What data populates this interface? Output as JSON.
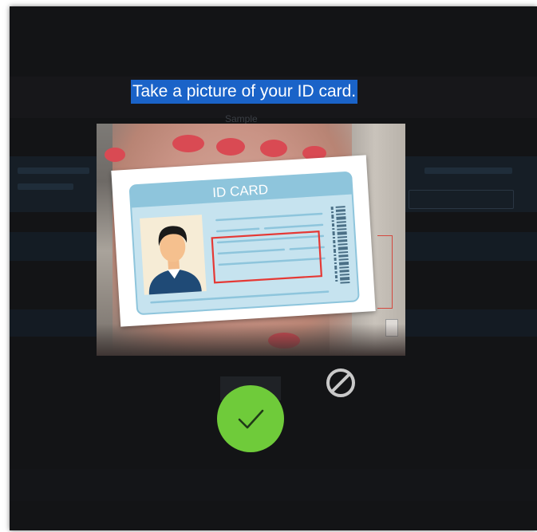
{
  "instruction": {
    "title": "Take a picture of your ID card.",
    "faint_label": "Sample"
  },
  "id_card": {
    "header_text": "ID CARD"
  },
  "actions": {
    "confirm_icon": "checkmark-icon",
    "cancel_icon": "prohibited-icon"
  },
  "colors": {
    "background": "#131416",
    "highlight": "#1a63c8",
    "confirm": "#6fcb3a",
    "card_accent": "#8ec5dc",
    "selection_box": "#e53935"
  }
}
